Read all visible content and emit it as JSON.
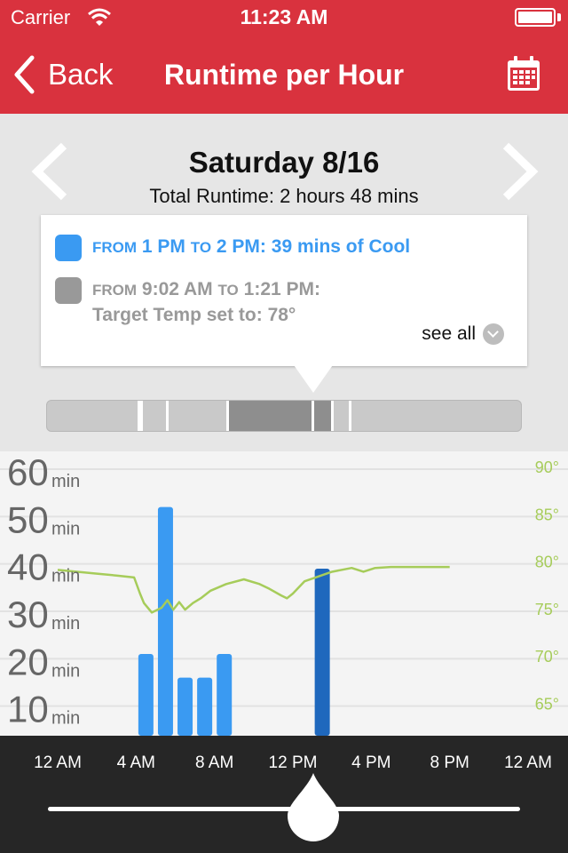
{
  "status_bar": {
    "carrier": "Carrier",
    "time": "11:23 AM",
    "battery_level": 1.0
  },
  "nav": {
    "back_label": "Back",
    "title": "Runtime per Hour",
    "calendar_icon": "calendar-icon"
  },
  "day": {
    "title": "Saturday 8/16",
    "total_runtime": "Total Runtime: 2 hours 48 mins",
    "prev_icon": "chevron-left-icon",
    "next_icon": "chevron-right-icon"
  },
  "events": [
    {
      "from_word": "FROM",
      "start": "1 PM",
      "to_word": "TO",
      "end": "2 PM:",
      "detail": "39 mins of Cool",
      "color": "#3a9af2"
    },
    {
      "from_word": "FROM",
      "start": "9:02 AM",
      "to_word": "TO",
      "end": "1:21 PM:",
      "detail": "Target Temp set to: 78°",
      "color": "#999999"
    }
  ],
  "see_all_label": "see all",
  "timeline": {
    "dark_segments": [
      [
        13.5,
        13.8
      ],
      [
        15.7,
        16.3
      ]
    ],
    "markers": [
      7,
      7.15,
      9,
      13.5,
      14.6,
      14.9
    ]
  },
  "chart_data": {
    "type": "bar",
    "runtime_unit": "min",
    "runtime_ticks": [
      {
        "value": 60,
        "label": "60"
      },
      {
        "value": 50,
        "label": "50"
      },
      {
        "value": 40,
        "label": "40"
      },
      {
        "value": 30,
        "label": "30"
      },
      {
        "value": 20,
        "label": "20"
      },
      {
        "value": 10,
        "label": "10"
      }
    ],
    "temp_ticks": [
      "90°",
      "85°",
      "80°",
      "75°",
      "70°",
      "65°"
    ],
    "temp_range": [
      60,
      90
    ],
    "runtime_range": [
      0,
      60
    ],
    "hours": [
      4,
      5,
      6,
      7,
      8,
      13,
      14
    ],
    "values": [
      21,
      52,
      16,
      16,
      21,
      39,
      3
    ],
    "bar_colors": [
      "#3a9af2",
      "#3a9af2",
      "#3a9af2",
      "#3a9af2",
      "#3a9af2",
      "#1f68bd",
      "#3a9af2"
    ],
    "temperature_series": {
      "color": "#a6cc5a",
      "points": [
        [
          0,
          79
        ],
        [
          1,
          78.8
        ],
        [
          2,
          78.6
        ],
        [
          3,
          78.4
        ],
        [
          3.9,
          78.2
        ],
        [
          4.2,
          76.5
        ],
        [
          4.4,
          75.5
        ],
        [
          4.8,
          74.5
        ],
        [
          5.3,
          75
        ],
        [
          5.6,
          75.8
        ],
        [
          5.9,
          74.8
        ],
        [
          6.2,
          75.6
        ],
        [
          6.5,
          74.8
        ],
        [
          6.9,
          75.5
        ],
        [
          7.3,
          76
        ],
        [
          7.8,
          76.8
        ],
        [
          8.6,
          77.5
        ],
        [
          9.5,
          78
        ],
        [
          10.3,
          77.5
        ],
        [
          10.8,
          77
        ],
        [
          11.4,
          76.3
        ],
        [
          11.7,
          76
        ],
        [
          12,
          76.5
        ],
        [
          12.6,
          77.8
        ],
        [
          14,
          78.8
        ],
        [
          15,
          79.2
        ],
        [
          15.6,
          78.8
        ],
        [
          16.2,
          79.2
        ],
        [
          17,
          79.3
        ],
        [
          19,
          79.3
        ],
        [
          20,
          79.3
        ]
      ]
    }
  },
  "x_axis": [
    "12 AM",
    "4 AM",
    "8 AM",
    "12 PM",
    "4 PM",
    "8 PM",
    "12 AM"
  ],
  "slider": {
    "position_hours": 13.5,
    "thumb_icon": "drop-icon"
  }
}
